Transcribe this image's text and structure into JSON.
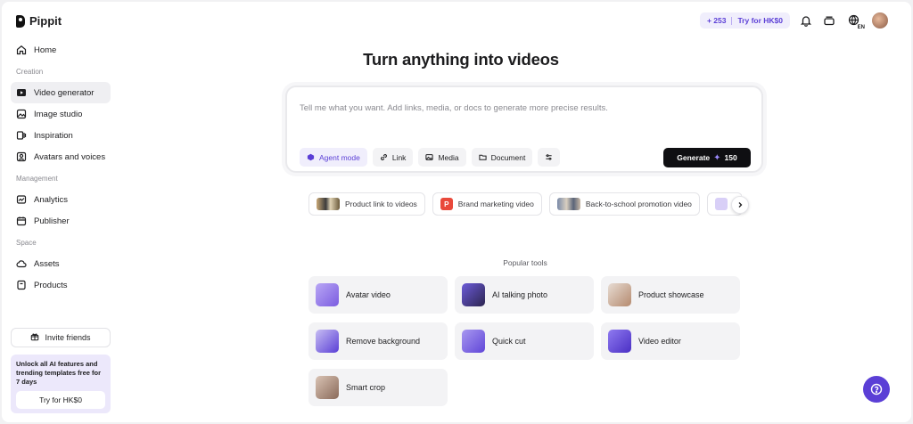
{
  "brand": {
    "name": "Pippit"
  },
  "sidebar": {
    "home": "Home",
    "sections": {
      "creation": "Creation",
      "management": "Management",
      "space": "Space"
    },
    "items": [
      {
        "label": "Video generator"
      },
      {
        "label": "Image studio"
      },
      {
        "label": "Inspiration"
      },
      {
        "label": "Avatars and voices"
      },
      {
        "label": "Analytics"
      },
      {
        "label": "Publisher"
      },
      {
        "label": "Assets"
      },
      {
        "label": "Products"
      }
    ],
    "invite": "Invite friends",
    "promo_text": "Unlock all AI features and trending templates free for 7 days",
    "promo_button": "Try for HK$0"
  },
  "topbar": {
    "credits": "+ 253",
    "trial": "Try for HK$0",
    "lang": "EN"
  },
  "main": {
    "title": "Turn anything into videos",
    "prompt_placeholder": "Tell me what you want. Add links, media, or docs to generate more precise results.",
    "chips": [
      "Agent mode",
      "Link",
      "Media",
      "Document"
    ],
    "generate_label": "Generate",
    "generate_cost": "150",
    "templates": [
      "Product link to videos",
      "Brand marketing video",
      "Back-to-school promotion video"
    ],
    "popular_label": "Popular tools",
    "tools": [
      "Avatar video",
      "AI talking photo",
      "Product showcase",
      "Remove background",
      "Quick cut",
      "Video editor",
      "Smart crop"
    ]
  },
  "colors": {
    "accent": "#5b3fd6",
    "accent_bg": "#f0eefc",
    "generate_bg": "#0f0f12"
  }
}
